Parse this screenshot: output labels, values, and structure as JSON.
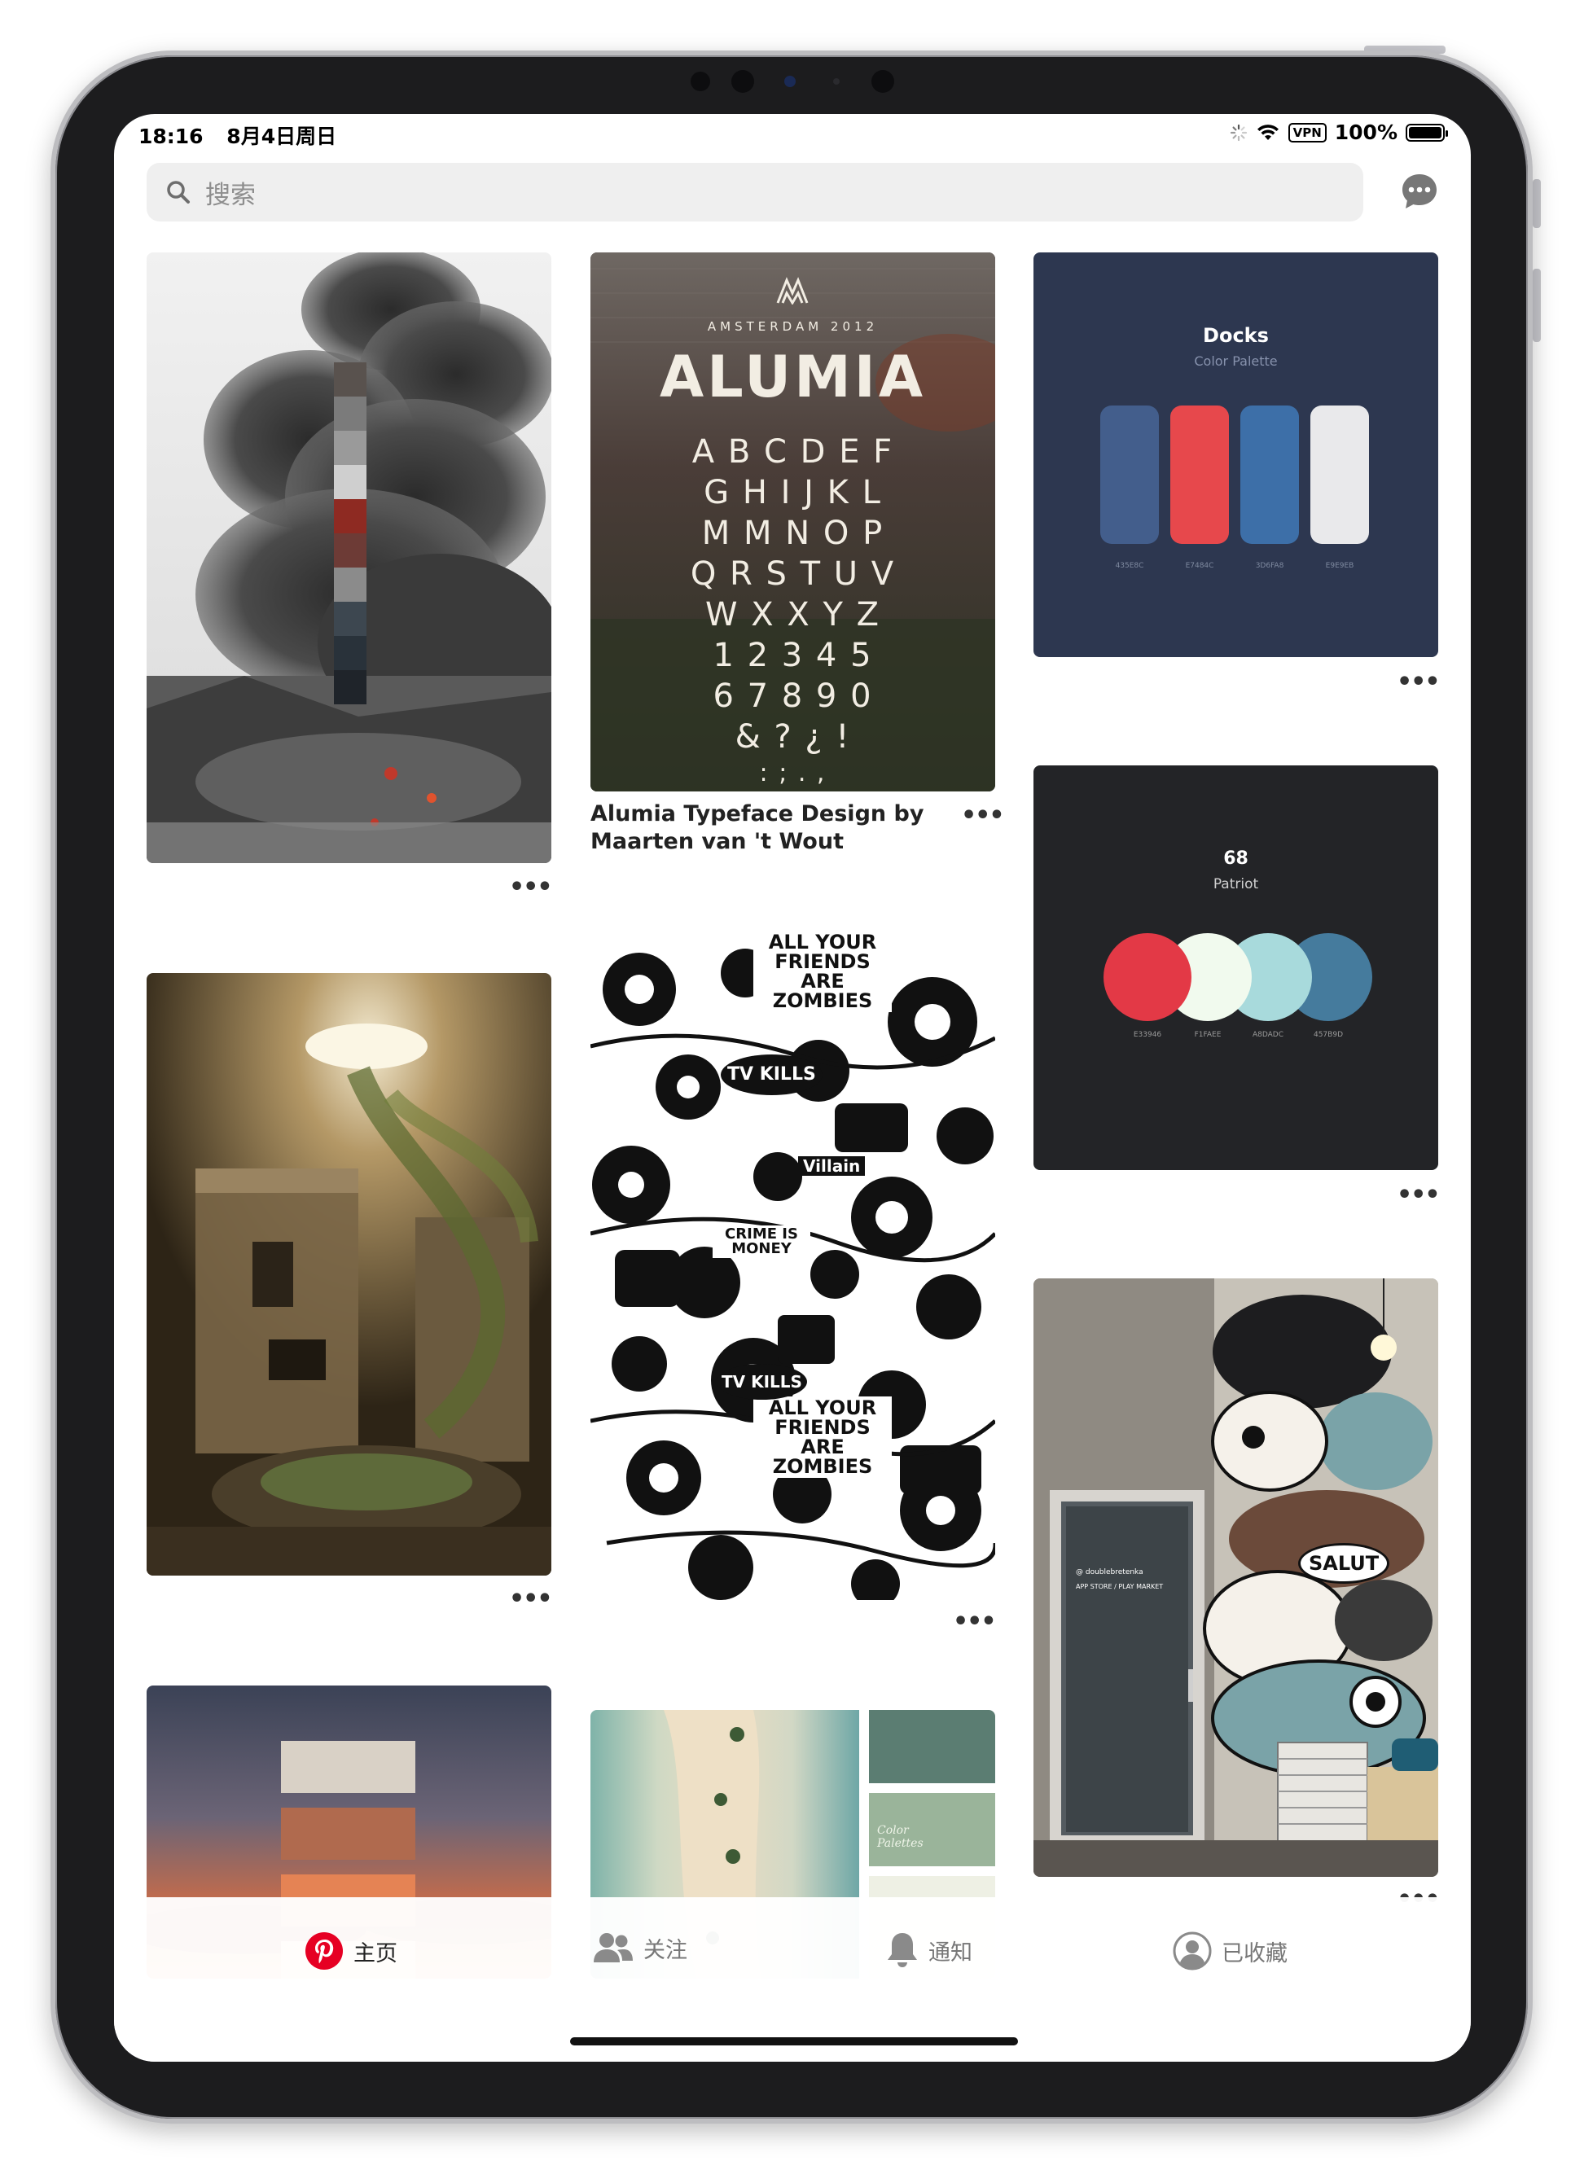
{
  "status_bar": {
    "time": "18:16",
    "date": "8月4日周日",
    "vpn": "VPN",
    "battery": "100%",
    "battery_level": 1.0
  },
  "search": {
    "placeholder": "搜索"
  },
  "pins": {
    "alumia": {
      "city": "AMSTERDAM 2012",
      "name": "ALUMIA",
      "rows": [
        "ABCDEF",
        "GHIJKL",
        "MMNOP",
        "QRSTUV",
        "WXXYZ",
        "12345",
        "67890",
        "&?¿!",
        ":;.,"
      ],
      "caption_line1": "Alumia Typeface Design by",
      "caption_line2": "Maarten van 't Wout"
    },
    "docks": {
      "title": "Docks",
      "subtitle": "Color Palette",
      "colors": [
        "#435E8C",
        "#E7484C",
        "#3D6FA8",
        "#E9E9EB"
      ],
      "hex": [
        "435E8C",
        "E7484C",
        "3D6FA8",
        "E9E9EB"
      ]
    },
    "patriot": {
      "number": "68",
      "name": "Patriot",
      "colors": [
        "#E33946",
        "#F1FAEE",
        "#A8DADC",
        "#457B9D"
      ],
      "hex": [
        "E33946",
        "F1FAEE",
        "A8DADC",
        "457B9D"
      ]
    },
    "zombies": {
      "headline1": "ALL YOUR FRIENDS ARE ZOMBIES",
      "tv": "TV KILLS",
      "crime": "CRIME IS MONEY",
      "villain": "Villain"
    },
    "mural": {
      "insta": "@ doublebretenka",
      "store": "APP STORE / PLAY MARKET",
      "salut": "SALUT"
    },
    "beach": {
      "label": "Color Palettes"
    }
  },
  "tabs": {
    "home": "主页",
    "following": "关注",
    "notifications": "通知",
    "saved": "已收藏"
  },
  "colors": {
    "accent": "#E60023",
    "card_dark": "#232427",
    "docks_bg": "#2D3750"
  }
}
